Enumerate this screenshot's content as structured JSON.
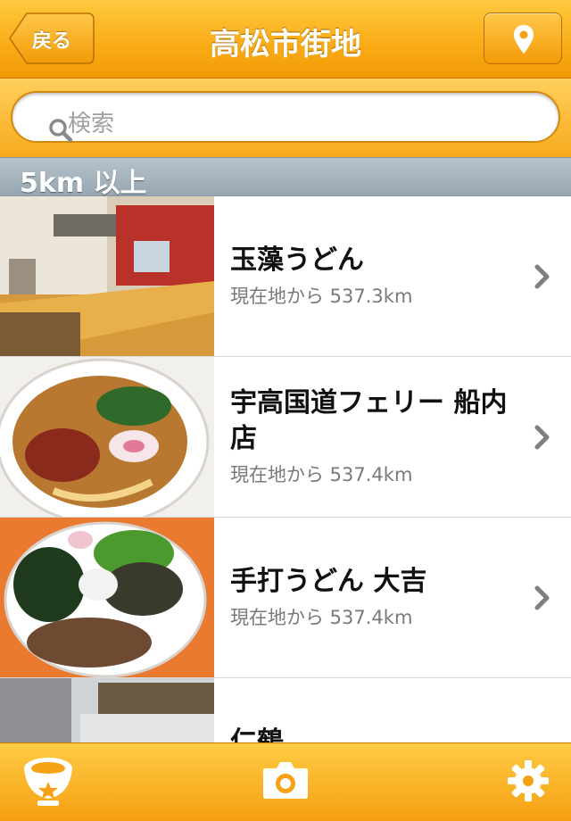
{
  "navbar": {
    "back_label": "戻る",
    "title": "高松市街地"
  },
  "search": {
    "placeholder": "検索"
  },
  "section": {
    "header": "5km 以上"
  },
  "restaurants": [
    {
      "name": "玉藻うどん",
      "distance": "現在地から 537.3km"
    },
    {
      "name": "宇高国道フェリー 船内店",
      "distance": "現在地から 537.4km"
    },
    {
      "name": "手打うどん 大吉",
      "distance": "現在地から 537.4km"
    },
    {
      "name": "仁鶴",
      "distance": ""
    }
  ],
  "tabs": [
    {
      "icon": "udon-bowl-star-icon"
    },
    {
      "icon": "camera-icon"
    },
    {
      "icon": "gear-icon"
    }
  ],
  "colors": {
    "accent": "#f9ab16",
    "section_header": "#a7b5bf"
  }
}
